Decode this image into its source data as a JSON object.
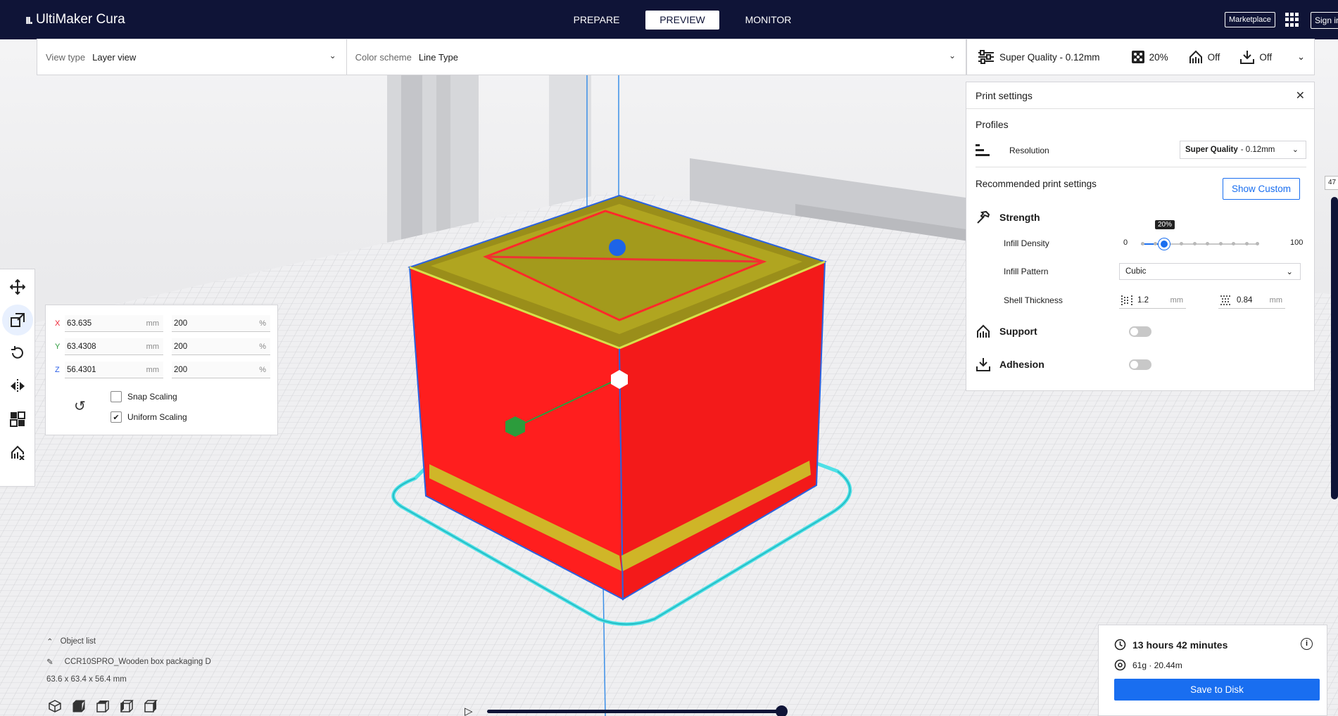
{
  "header": {
    "app_name": "UltiMaker Cura",
    "stages": [
      "PREPARE",
      "PREVIEW",
      "MONITOR"
    ],
    "active_stage": "PREVIEW",
    "marketplace_label": "Marketplace",
    "signin_label": "Sign in"
  },
  "viewbar": {
    "view_type_label": "View type",
    "view_type_value": "Layer view",
    "color_scheme_label": "Color scheme",
    "color_scheme_value": "Line Type"
  },
  "qualitybar": {
    "profile": "Super Quality - 0.12mm",
    "infill": "20%",
    "support": "Off",
    "adhesion": "Off"
  },
  "print_settings": {
    "title": "Print settings",
    "profiles_label": "Profiles",
    "resolution_label": "Resolution",
    "resolution_value_bold": "Super Quality",
    "resolution_value_rest": "- 0.12mm",
    "recommended_label": "Recommended print settings",
    "show_custom_label": "Show Custom",
    "strength_label": "Strength",
    "infill_density_label": "Infill Density",
    "infill_min": "0",
    "infill_max": "100",
    "infill_value": 20,
    "infill_tooltip": "20%",
    "infill_pattern_label": "Infill Pattern",
    "infill_pattern_value": "Cubic",
    "shell_thickness_label": "Shell Thickness",
    "wall_thickness": "1.2",
    "top_bottom_thickness": "0.84",
    "unit_mm": "mm",
    "support_label": "Support",
    "adhesion_label": "Adhesion"
  },
  "scale_tool": {
    "x_label": "X",
    "x_mm": "63.635",
    "x_pct": "200",
    "y_label": "Y",
    "y_mm": "63.4308",
    "y_pct": "200",
    "z_label": "Z",
    "z_mm": "56.4301",
    "z_pct": "200",
    "unit_mm": "mm",
    "unit_pct": "%",
    "snap_scaling_label": "Snap Scaling",
    "uniform_scaling_label": "Uniform Scaling"
  },
  "object_list": {
    "header": "Object list",
    "object_name": "CCR10SPRO_Wooden box packaging D",
    "dimensions": "63.6 x 63.4 x 56.4 mm"
  },
  "layer_slider": {
    "layer_value": "47"
  },
  "estimate": {
    "time": "13 hours 42 minutes",
    "material": "61g · 20.44m",
    "save_label": "Save to Disk"
  },
  "colors": {
    "header_bg": "#0f1437",
    "accent_blue": "#196ef0",
    "model_red": "#ff1e1e",
    "infill_yellow": "#c8d12a",
    "skirt_cyan": "#4ee0e6"
  }
}
